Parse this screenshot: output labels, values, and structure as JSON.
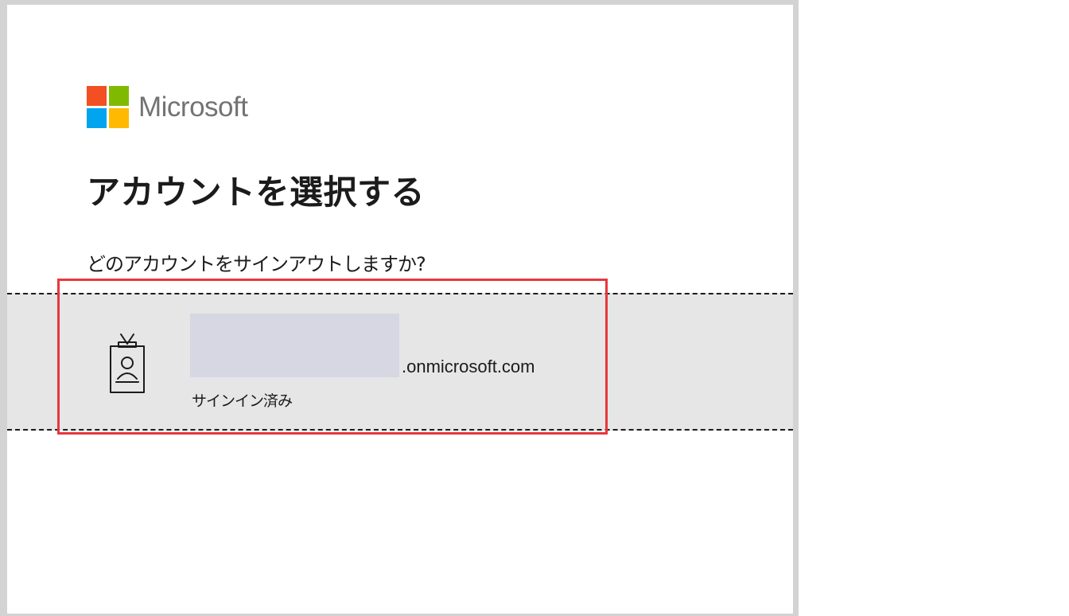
{
  "brand": {
    "name": "Microsoft",
    "logo_colors": [
      "#f25022",
      "#7fba00",
      "#00a4ef",
      "#ffb900"
    ]
  },
  "page": {
    "title": "アカウントを選択する",
    "prompt": "どのアカウントをサインアウトしますか?"
  },
  "accounts": [
    {
      "icon": "badge-icon",
      "email_domain": ".onmicrosoft.com",
      "status": "サインイン済み"
    }
  ],
  "annotation": {
    "highlight_color": "#e8373d"
  }
}
